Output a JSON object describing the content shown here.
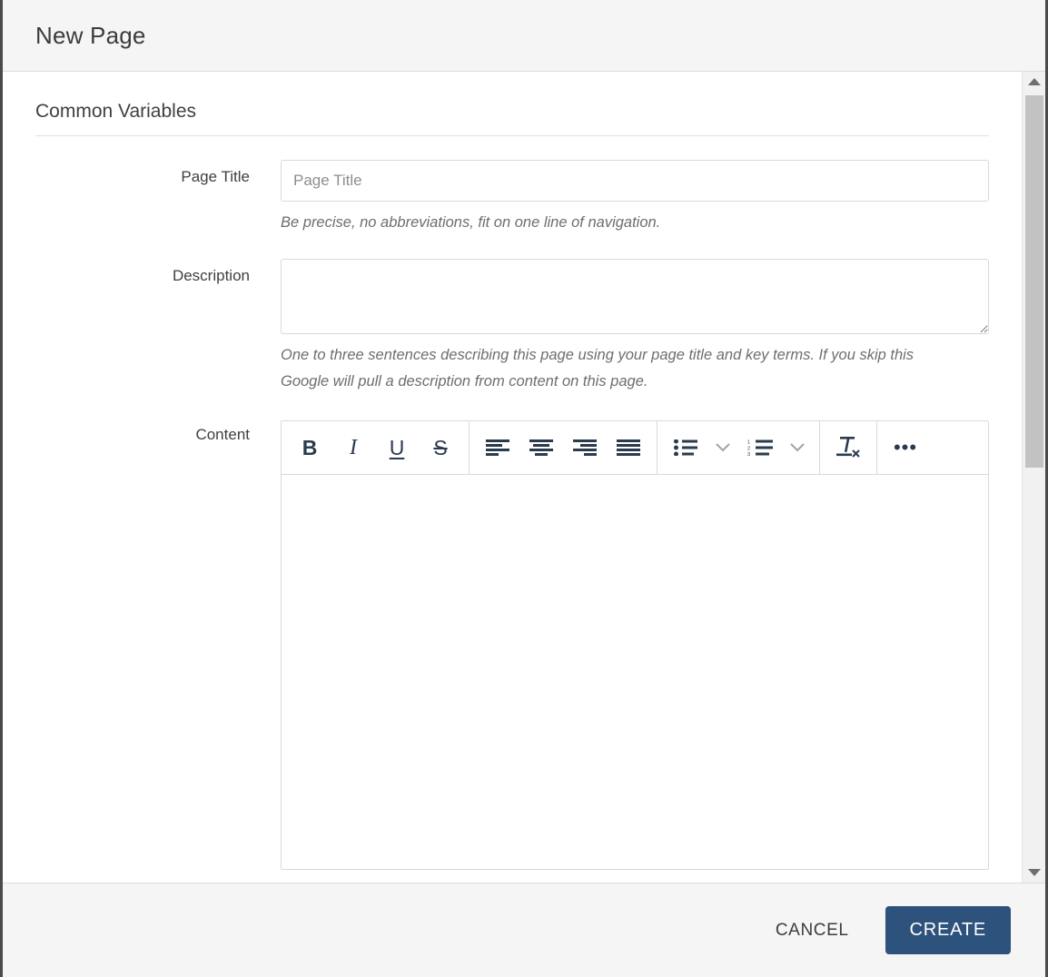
{
  "dialog": {
    "title": "New Page"
  },
  "section": {
    "heading": "Common Variables"
  },
  "fields": {
    "page_title": {
      "label": "Page Title",
      "placeholder": "Page Title",
      "value": "",
      "help": "Be precise, no abbreviations, fit on one line of navigation."
    },
    "description": {
      "label": "Description",
      "placeholder": "",
      "value": "",
      "help": "One to three sentences describing this page using your page title and key terms. If you skip this Google will pull a description from content on this page."
    },
    "content": {
      "label": "Content",
      "value": ""
    }
  },
  "toolbar": {
    "groups": [
      {
        "name": "text-style",
        "buttons": [
          {
            "icon": "bold-icon",
            "glyph": "B"
          },
          {
            "icon": "italic-icon",
            "glyph": "I"
          },
          {
            "icon": "underline-icon",
            "glyph": "U"
          },
          {
            "icon": "strikethrough-icon",
            "glyph": "S"
          }
        ]
      },
      {
        "name": "alignment",
        "buttons": [
          {
            "icon": "align-left-icon",
            "glyph": ""
          },
          {
            "icon": "align-center-icon",
            "glyph": ""
          },
          {
            "icon": "align-right-icon",
            "glyph": ""
          },
          {
            "icon": "align-justify-icon",
            "glyph": ""
          }
        ]
      },
      {
        "name": "lists",
        "buttons": [
          {
            "icon": "bulleted-list-icon",
            "glyph": ""
          },
          {
            "icon": "chevron-down-icon",
            "glyph": ""
          },
          {
            "icon": "numbered-list-icon",
            "glyph": ""
          },
          {
            "icon": "chevron-down-icon",
            "glyph": ""
          }
        ]
      },
      {
        "name": "clear-format",
        "buttons": [
          {
            "icon": "remove-format-icon",
            "glyph": ""
          }
        ]
      },
      {
        "name": "overflow",
        "buttons": [
          {
            "icon": "more-options-icon",
            "glyph": "•••"
          }
        ]
      }
    ]
  },
  "scrollbar": {
    "up_icon": "scroll-up-arrow-icon",
    "down_icon": "scroll-down-arrow-icon"
  },
  "footer": {
    "cancel_label": "CANCEL",
    "create_label": "CREATE"
  },
  "colors": {
    "accent": "#2d527c",
    "toolbar_icon": "#2b3b4e",
    "chrome": "#f5f5f5",
    "border": "#d9d9d9"
  }
}
